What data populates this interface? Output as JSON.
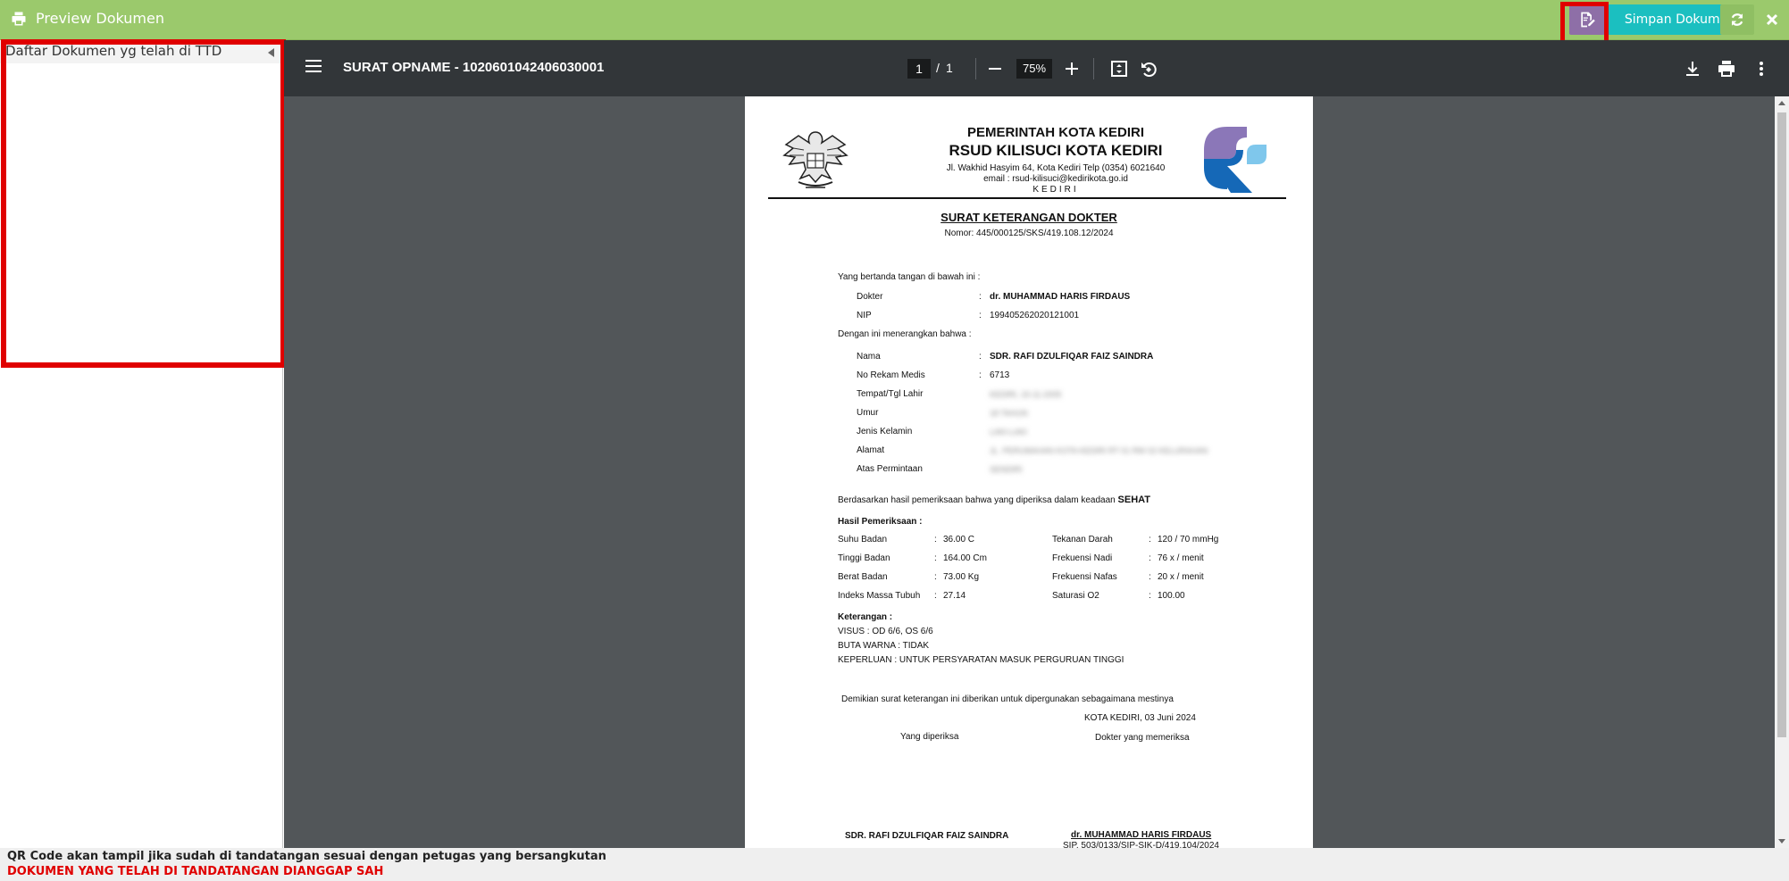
{
  "app": {
    "title": "Preview Dokumen",
    "save_label": "Simpan Dokumen"
  },
  "left_panel": {
    "header": "Daftar Dokumen yg telah di TTD"
  },
  "pdf_toolbar": {
    "doc_title": "SURAT OPNAME - 1020601042406030001",
    "page_current": "1",
    "page_sep": "/",
    "page_total": "1",
    "zoom": "75%"
  },
  "letterhead": {
    "line1": "PEMERINTAH KOTA KEDIRI",
    "line2": "RSUD KILISUCI KOTA KEDIRI",
    "address": "Jl. Wakhid Hasyim 64, Kota Kediri Telp (0354) 6021640",
    "email": "email : rsud-kilisuci@kedirikota.go.id",
    "city": "KEDIRI"
  },
  "document": {
    "heading": "SURAT KETERANGAN DOKTER",
    "number": "Nomor: 445/000125/SKS/419.108.12/2024",
    "intro": "Yang bertanda tangan di bawah ini  :",
    "doctor_label": "Dokter",
    "doctor_value": "dr. MUHAMMAD HARIS FIRDAUS",
    "nip_label": "NIP",
    "nip_value": "199405262020121001",
    "declare": "Dengan ini menerangkan bahwa :",
    "patient": [
      {
        "label": "Nama",
        "value": "SDR. RAFI DZULFIQAR FAIZ SAINDRA",
        "bold": true
      },
      {
        "label": "No Rekam Medis",
        "value": "6713",
        "bold": false
      },
      {
        "label": "Tempat/Tgl Lahir",
        "value": "KEDIRI, 15-11-2005",
        "blur": true
      },
      {
        "label": "Umur",
        "value": "18 TAHUN",
        "blur": true
      },
      {
        "label": "Jenis Kelamin",
        "value": "LAKI-LAKI",
        "blur": true
      },
      {
        "label": "Alamat",
        "value": "JL. PERUMAHAN KOTA KEDIRI RT 01 RW 02 KELURAHAN",
        "blur": true
      },
      {
        "label": "Atas Permintaan",
        "value": "SENDIRI",
        "blur": true
      }
    ],
    "result_intro": "Berdasarkan hasil pemeriksaan bahwa yang diperiksa dalam keadaan",
    "result_status": "SEHAT",
    "exam_title": "Hasil Pemeriksaan :",
    "exam_left": [
      {
        "label": "Suhu Badan",
        "value": "36.00  C"
      },
      {
        "label": "Tinggi Badan",
        "value": "164.00 Cm"
      },
      {
        "label": "Berat Badan",
        "value": "73.00 Kg"
      },
      {
        "label": "Indeks Massa Tubuh",
        "value": "27.14"
      }
    ],
    "exam_right": [
      {
        "label": "Tekanan Darah",
        "value": "120 / 70 mmHg"
      },
      {
        "label": "Frekuensi Nadi",
        "value": "76  x / menit"
      },
      {
        "label": "Frekuensi Nafas",
        "value": "20  x / menit"
      },
      {
        "label": "Saturasi O2",
        "value": "100.00"
      }
    ],
    "notes_title": "Keterangan :",
    "notes": [
      "VISUS : OD 6/6, OS 6/6",
      "BUTA WARNA : TIDAK",
      "KEPERLUAN : UNTUK PERSYARATAN MASUK PERGURUAN TINGGI"
    ],
    "closing": "Demikian surat keterangan ini diberikan untuk dipergunakan sebagaimana mestinya",
    "place_date": "KOTA KEDIRI, 03 Juni 2024",
    "sign_left_label": "Yang diperiksa",
    "sign_right_label": "Dokter yang memeriksa",
    "sign_left_name": "SDR. RAFI DZULFIQAR FAIZ SAINDRA",
    "sign_right_name": "dr. MUHAMMAD HARIS FIRDAUS",
    "sign_right_sip": "SIP. 503/0133/SIP-SIK-D/419.104/2024"
  },
  "footer": {
    "line1": "QR Code akan tampil jika sudah di tandatangan sesuai dengan petugas yang bersangkutan",
    "line2": "DOKUMEN YANG TELAH DI TANDATANGAN DIANGGAP SAH"
  },
  "colors": {
    "topbar": "#9bc96c",
    "save_button": "#1bbfc0",
    "sign_button": "#8e6fa7",
    "highlight": "#e00000",
    "arrow": "#ffc107",
    "footer_warning": "#e00000"
  },
  "icons": [
    "print-icon",
    "sign-document-icon",
    "refresh-icon",
    "close-icon",
    "menu-icon",
    "zoom-out-icon",
    "zoom-in-icon",
    "fit-page-icon",
    "rotate-icon",
    "download-icon",
    "more-icon"
  ]
}
